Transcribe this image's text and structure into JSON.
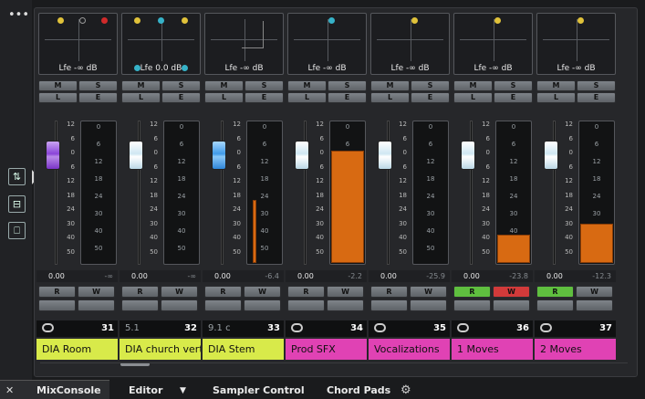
{
  "app": {
    "menu_glyph": "•••"
  },
  "left_tools": [
    {
      "icon": "fader-settings-icon",
      "glyph": "⇅"
    },
    {
      "icon": "routing-icon",
      "glyph": "⊟"
    },
    {
      "icon": "monitor-icon",
      "glyph": "⎕"
    }
  ],
  "fader_scale": [
    "12",
    "6",
    "0",
    "6",
    "12",
    "18",
    "24",
    "30",
    "40",
    "50"
  ],
  "meter_scale": [
    "0",
    "6",
    "12",
    "18",
    "24",
    "30",
    "40",
    "50"
  ],
  "buttons": {
    "mute": "M",
    "solo": "S",
    "listen": "L",
    "edit": "E",
    "read": "R",
    "write": "W"
  },
  "channels": [
    {
      "lfe": "Lfe -∞ dB",
      "vol": "0.00",
      "peak": "-∞",
      "num": "31",
      "sub": "",
      "link": "stereo-link-icon",
      "name": "DIA Room",
      "color": "#d8ea4a",
      "fader": "purple",
      "meter": 0,
      "rw_active": false
    },
    {
      "lfe": "Lfe 0.0 dB",
      "vol": "0.00",
      "peak": "-∞",
      "num": "32",
      "sub": "5.1",
      "link": "",
      "name": "DIA church vert",
      "color": "#d8ea4a",
      "fader": "white",
      "meter": 0,
      "rw_active": false
    },
    {
      "lfe": "Lfe -∞ dB",
      "vol": "0.00",
      "peak": "-6.4",
      "num": "33",
      "sub": "9.1 c",
      "link": "",
      "name": "DIA Stem",
      "color": "#d8ea4a",
      "fader": "blue",
      "meter": 0.45,
      "rw_active": false
    },
    {
      "lfe": "Lfe -∞ dB",
      "vol": "0.00",
      "peak": "-2.2",
      "num": "34",
      "sub": "",
      "link": "mono-icon",
      "name": "Prod SFX",
      "color": "#e042b4",
      "fader": "white",
      "meter": 0.8,
      "rw_active": false
    },
    {
      "lfe": "Lfe -∞ dB",
      "vol": "0.00",
      "peak": "-25.9",
      "num": "35",
      "sub": "",
      "link": "stereo-link-icon",
      "name": "Vocalizations",
      "color": "#e042b4",
      "fader": "white",
      "meter": 0,
      "rw_active": false
    },
    {
      "lfe": "Lfe -∞ dB",
      "vol": "0.00",
      "peak": "-23.8",
      "num": "36",
      "sub": "",
      "link": "stereo-link-icon",
      "name": "1 Moves",
      "color": "#e042b4",
      "fader": "white",
      "meter": 0.2,
      "rw_active": true
    },
    {
      "lfe": "Lfe -∞ dB",
      "vol": "0.00",
      "peak": "-12.3",
      "num": "37",
      "sub": "",
      "link": "stereo-link-icon",
      "name": "2 Moves",
      "color": "#e042b4",
      "fader": "white",
      "meter": 0.28,
      "rw_active": "r"
    }
  ],
  "tabs": {
    "mixconsole": "MixConsole",
    "editor": "Editor",
    "sampler": "Sampler Control",
    "chordpads": "Chord Pads",
    "close_glyph": "✕",
    "dropdown_glyph": "▼",
    "gear_glyph": "⚙"
  },
  "colors": {
    "meter": "#d86a12",
    "read_active": "#5fbf3f",
    "write_active": "#d23a3a"
  }
}
